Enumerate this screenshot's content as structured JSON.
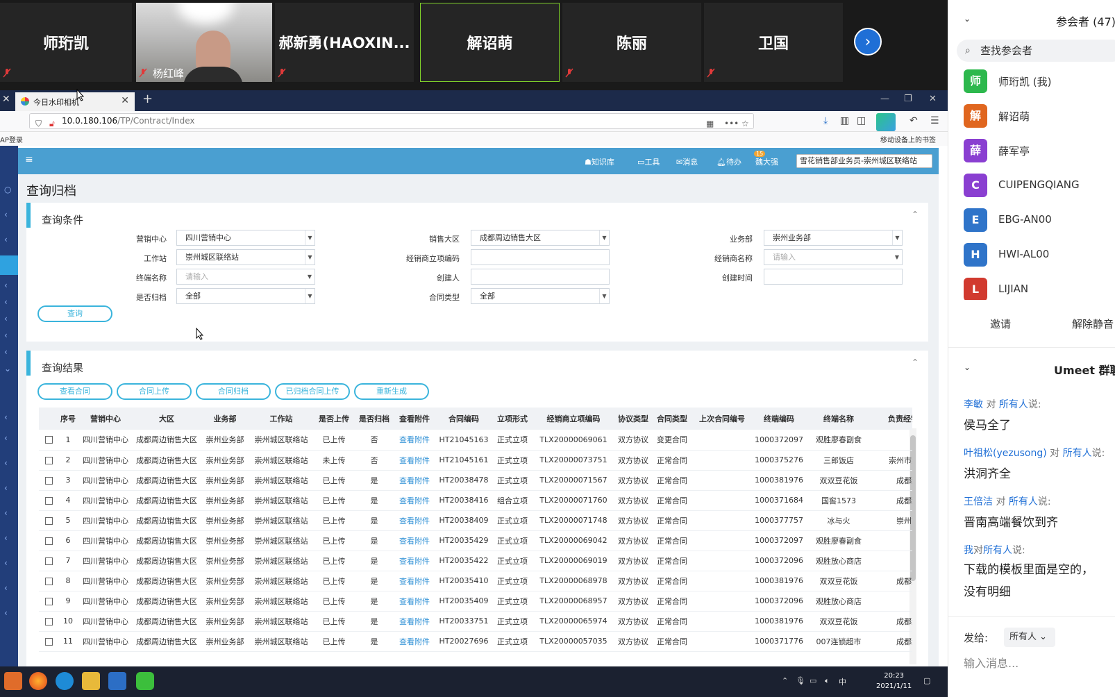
{
  "meeting": {
    "tiles": [
      {
        "name": "师珩凯",
        "muted": true
      },
      {
        "name": "",
        "caption": "杨红峰",
        "muted": true,
        "video": true
      },
      {
        "name": "郝新勇(HAOXIN...",
        "muted": true
      },
      {
        "name": "解诏萌",
        "muted": false,
        "active": true
      },
      {
        "name": "陈丽",
        "muted": true
      },
      {
        "name": "卫国",
        "muted": true
      }
    ],
    "next_icon": "chevron-right-icon"
  },
  "browser": {
    "tab_title": "今日水印相机",
    "url_host": "10.0.180.106",
    "url_path": "/TP/Contract/Index",
    "bookmark_left": "AP登录",
    "bookmark_right": "移动设备上的书签"
  },
  "app": {
    "header": {
      "items": [
        "知识库",
        "工具",
        "消息",
        "待办",
        "魏大强"
      ],
      "badge": "15",
      "role_select": "雪花销售部业务员-崇州城区联络站"
    },
    "page_title": "查询归档",
    "query_panel": {
      "title": "查询条件",
      "fields": [
        {
          "label": "营销中心",
          "value": "四川营销中心",
          "type": "select"
        },
        {
          "label": "销售大区",
          "value": "成都周边销售大区",
          "type": "select"
        },
        {
          "label": "业务部",
          "value": "崇州业务部",
          "type": "select"
        },
        {
          "label": "工作站",
          "value": "崇州城区联络站",
          "type": "select"
        },
        {
          "label": "经销商立项编码",
          "value": "",
          "type": "text"
        },
        {
          "label": "经销商名称",
          "placeholder": "请输入",
          "type": "select"
        },
        {
          "label": "终端名称",
          "placeholder": "请输入",
          "type": "select"
        },
        {
          "label": "创建人",
          "value": "",
          "type": "text"
        },
        {
          "label": "创建时间",
          "value": "",
          "type": "text"
        },
        {
          "label": "是否归档",
          "value": "全部",
          "type": "select"
        },
        {
          "label": "合同类型",
          "value": "全部",
          "type": "select"
        }
      ],
      "search_button": "查询"
    },
    "result_panel": {
      "title": "查询结果",
      "buttons": [
        "查看合同",
        "合同上传",
        "合同归档",
        "已归档合同上传",
        "重新生成"
      ],
      "columns": [
        "",
        "序号",
        "营销中心",
        "大区",
        "业务部",
        "工作站",
        "是否上传",
        "是否归档",
        "查看附件",
        "合同编码",
        "立项形式",
        "经销商立项编码",
        "协议类型",
        "合同类型",
        "上次合同编号",
        "终端编码",
        "终端名称",
        "负责经销"
      ],
      "rows": [
        [
          "1",
          "四川营销中心",
          "成都周边销售大区",
          "崇州业务部",
          "崇州城区联络站",
          "已上传",
          "否",
          "查看附件",
          "HT21045163",
          "正式立项",
          "TLX20000069061",
          "双方协议",
          "变更合同",
          "",
          "1000372097",
          "观胜廖春副食",
          "崇州"
        ],
        [
          "2",
          "四川营销中心",
          "成都周边销售大区",
          "崇州业务部",
          "崇州城区联络站",
          "未上传",
          "否",
          "查看附件",
          "HT21045161",
          "正式立项",
          "TLX20000073751",
          "双方协议",
          "正常合同",
          "",
          "1000375276",
          "三郎饭店",
          "崇州市崇阳鑫"
        ],
        [
          "3",
          "四川营销中心",
          "成都周边销售大区",
          "崇州业务部",
          "崇州城区联络站",
          "已上传",
          "是",
          "查看附件",
          "HT20038478",
          "正式立项",
          "TLX20000071567",
          "双方协议",
          "正常合同",
          "",
          "1000381976",
          "双双豆花饭",
          "成都金裕贸"
        ],
        [
          "4",
          "四川营销中心",
          "成都周边销售大区",
          "崇州业务部",
          "崇州城区联络站",
          "已上传",
          "是",
          "查看附件",
          "HT20038416",
          "组合立项",
          "TLX20000071760",
          "双方协议",
          "正常合同",
          "",
          "1000371684",
          "国窖1573",
          "成都金裕贸"
        ],
        [
          "5",
          "四川营销中心",
          "成都周边销售大区",
          "崇州业务部",
          "崇州城区联络站",
          "已上传",
          "是",
          "查看附件",
          "HT20038409",
          "正式立项",
          "TLX20000071748",
          "双方协议",
          "正常合同",
          "",
          "1000377757",
          "冰与火",
          "崇州市崇阳"
        ],
        [
          "6",
          "四川营销中心",
          "成都周边销售大区",
          "崇州业务部",
          "崇州城区联络站",
          "已上传",
          "是",
          "查看附件",
          "HT20035429",
          "正式立项",
          "TLX20000069042",
          "双方协议",
          "正常合同",
          "",
          "1000372097",
          "观胜廖春副食",
          "崇州"
        ],
        [
          "7",
          "四川营销中心",
          "成都周边销售大区",
          "崇州业务部",
          "崇州城区联络站",
          "已上传",
          "是",
          "查看附件",
          "HT20035422",
          "正式立项",
          "TLX20000069019",
          "双方协议",
          "正常合同",
          "",
          "1000372096",
          "观胜放心商店",
          "崇州"
        ],
        [
          "8",
          "四川营销中心",
          "成都周边销售大区",
          "崇州业务部",
          "崇州城区联络站",
          "已上传",
          "是",
          "查看附件",
          "HT20035410",
          "正式立项",
          "TLX20000068978",
          "双方协议",
          "正常合同",
          "",
          "1000381976",
          "双双豆花饭",
          "成都金裕贸"
        ],
        [
          "9",
          "四川营销中心",
          "成都周边销售大区",
          "崇州业务部",
          "崇州城区联络站",
          "已上传",
          "是",
          "查看附件",
          "HT20035409",
          "正式立项",
          "TLX20000068957",
          "双方协议",
          "正常合同",
          "",
          "1000372096",
          "观胜放心商店",
          "崇州"
        ],
        [
          "10",
          "四川营销中心",
          "成都周边销售大区",
          "崇州业务部",
          "崇州城区联络站",
          "已上传",
          "是",
          "查看附件",
          "HT20033751",
          "正式立项",
          "TLX20000065974",
          "双方协议",
          "正常合同",
          "",
          "1000381976",
          "双双豆花饭",
          "成都金裕贸"
        ],
        [
          "11",
          "四川营销中心",
          "成都周边销售大区",
          "崇州业务部",
          "崇州城区联络站",
          "已上传",
          "是",
          "查看附件",
          "HT20027696",
          "正式立项",
          "TLX20000057035",
          "双方协议",
          "正常合同",
          "",
          "1000371776",
          "007连锁超市",
          "成都金裕贸"
        ]
      ]
    }
  },
  "taskbar": {
    "time": "20:23",
    "date": "2021/1/11",
    "ime": "中"
  },
  "side": {
    "participants_title": "参会者 (47)",
    "search_placeholder": "查找参会者",
    "participants": [
      {
        "avatar": "师",
        "name": "师珩凯 (我)",
        "color": "#2db84d"
      },
      {
        "avatar": "解",
        "name": "解诏萌",
        "color": "#e0661f"
      },
      {
        "avatar": "薛",
        "name": "薛军亭",
        "color": "#8a3fd1"
      },
      {
        "avatar": "C",
        "name": "CUIPENGQIANG",
        "color": "#8a3fd1"
      },
      {
        "avatar": "E",
        "name": "EBG-AN00",
        "color": "#2f74c9"
      },
      {
        "avatar": "H",
        "name": "HWI-AL00",
        "color": "#2f74c9"
      },
      {
        "avatar": "L",
        "name": "LIJIAN",
        "color": "#d13a2f"
      }
    ],
    "invite": "邀请",
    "unmute_all": "解除静音",
    "chat_title": "Umeet 群聊",
    "messages": [
      {
        "from": "李敏",
        "mid": " 对 ",
        "to": "所有人",
        "tail": "说:",
        "text": [
          "侯马全了"
        ]
      },
      {
        "from": "叶祖松(yezusong)",
        "mid": " 对 ",
        "to": "所有人",
        "tail": "说:",
        "text": [
          "洪洞齐全"
        ]
      },
      {
        "from": "王倍洁",
        "mid": " 对 ",
        "to": "所有人",
        "tail": "说:",
        "text": [
          "晋南高端餐饮到齐"
        ]
      },
      {
        "from": "我",
        "mid": "对",
        "to": "所有人",
        "tail": "说:",
        "text": [
          "下载的模板里面是空的，",
          "没有明细"
        ]
      }
    ],
    "send_to_label": "发给:",
    "send_to_value": "所有人",
    "input_placeholder": "输入消息..."
  }
}
